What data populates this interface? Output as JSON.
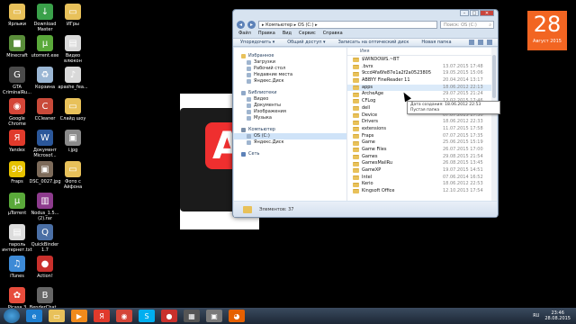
{
  "desktop_icons": [
    {
      "label": "Ярлыки",
      "icon": "folder-icon",
      "color": "#e8c15a",
      "glyph": "▭"
    },
    {
      "label": "Download\nMaster",
      "icon": "download-icon",
      "color": "#3aa14a",
      "glyph": "↓"
    },
    {
      "label": "ИГры",
      "icon": "folder-icon",
      "color": "#e8c15a",
      "glyph": "▭"
    },
    {
      "label": "Minecraft",
      "icon": "grass-block-icon",
      "color": "#5a8e3a",
      "glyph": "■"
    },
    {
      "label": "utorrent.exe",
      "icon": "utorrent-icon",
      "color": "#5aa93a",
      "glyph": "µ"
    },
    {
      "label": "Видео\nвлюкон",
      "icon": "document-icon",
      "color": "#d9d9d9",
      "glyph": "▤"
    },
    {
      "label": "GTA\nCriminalRu...",
      "icon": "gta-icon",
      "color": "#4b4b4b",
      "glyph": "G"
    },
    {
      "label": "Корзина",
      "icon": "recycle-bin-icon",
      "color": "#9bb7d4",
      "glyph": "♻"
    },
    {
      "label": "apashe_fea...",
      "icon": "audio-file-icon",
      "color": "#d9d9d9",
      "glyph": "♪"
    },
    {
      "label": "Google\nChrome",
      "icon": "chrome-icon",
      "color": "#d44638",
      "glyph": "◉"
    },
    {
      "label": "CCleaner",
      "icon": "ccleaner-icon",
      "color": "#c94a3a",
      "glyph": "C"
    },
    {
      "label": "Слайд шоу",
      "icon": "folder-icon",
      "color": "#e8c15a",
      "glyph": "▭"
    },
    {
      "label": "Yandex",
      "icon": "yandex-icon",
      "color": "#e03a2b",
      "glyph": "Я"
    },
    {
      "label": "Документ\nMicrosof...",
      "icon": "word-icon",
      "color": "#2b579a",
      "glyph": "W"
    },
    {
      "label": "i.jpg",
      "icon": "image-file-icon",
      "color": "#8a8a8a",
      "glyph": "▣"
    },
    {
      "label": "Fraps",
      "icon": "fraps-icon",
      "color": "#e6c200",
      "glyph": "99"
    },
    {
      "label": "DSC_0027.jpg",
      "icon": "image-file-icon",
      "color": "#7d6b5a",
      "glyph": "▣"
    },
    {
      "label": "Фото с\nАйфона",
      "icon": "folder-icon",
      "color": "#e8c15a",
      "glyph": "▭"
    },
    {
      "label": "µTorrent",
      "icon": "utorrent-icon",
      "color": "#5aa93a",
      "glyph": "µ"
    },
    {
      "label": "Nodus_1.5...\n(2).rar",
      "icon": "archive-icon",
      "color": "#8d3b8d",
      "glyph": "▥"
    },
    {
      "label": "",
      "icon": "blank-icon",
      "color": "#000000",
      "glyph": ""
    },
    {
      "label": "пароль\nинтернет.txt",
      "icon": "text-file-icon",
      "color": "#dcdcdc",
      "glyph": "▤"
    },
    {
      "label": "QuickBinder\n1.7",
      "icon": "app-icon",
      "color": "#4a6fa5",
      "glyph": "Q"
    },
    {
      "label": "",
      "icon": "blank-icon",
      "color": "#000000",
      "glyph": ""
    },
    {
      "label": "iTunes",
      "icon": "itunes-icon",
      "color": "#3d8ad6",
      "glyph": "♫"
    },
    {
      "label": "Action!",
      "icon": "action-icon",
      "color": "#c9302c",
      "glyph": "●"
    },
    {
      "label": "",
      "icon": "blank-icon",
      "color": "#000000",
      "glyph": ""
    },
    {
      "label": "Picasa 3",
      "icon": "picasa-icon",
      "color": "#e74c3c",
      "glyph": "✿"
    },
    {
      "label": "BenderChat...",
      "icon": "app-icon",
      "color": "#666666",
      "glyph": "B"
    }
  ],
  "window": {
    "address": "▸ Компьютер ▸ OS (C:) ▸",
    "search_placeholder": "Поиск: OS (C:)",
    "menu": [
      "Файл",
      "Правка",
      "Вид",
      "Сервис",
      "Справка"
    ],
    "toolbar": [
      "Упорядочить ▾",
      "Общий доступ ▾",
      "Записать на оптический диск",
      "Новая папка"
    ],
    "nav": {
      "favorites_header": "Избранное",
      "favorites": [
        "Загрузки",
        "Рабочий стол",
        "Недавние места",
        "Яндекс.Диск"
      ],
      "libraries_header": "Библиотеки",
      "libraries": [
        "Видео",
        "Документы",
        "Изображения",
        "Музыка"
      ],
      "computer_header": "Компьютер",
      "computer": [
        "OS (C:)",
        "Яндекс.Диск"
      ],
      "network_header": "Сеть"
    },
    "column_name": "Имя",
    "files": [
      {
        "name": "$WINDOWS.~BT",
        "date": "",
        "hl": false
      },
      {
        "name": ".bvrx",
        "date": "13.07.2015 17:48",
        "hl": false
      },
      {
        "name": "9ccd4fa6fe87e1a2f2a0523805",
        "date": "19.05.2015 15:06",
        "hl": false
      },
      {
        "name": "ABBYY FineReader 11",
        "date": "20.04.2014 13:17",
        "hl": false
      },
      {
        "name": "apps",
        "date": "18.06.2012 22:13",
        "hl": true
      },
      {
        "name": "ArcheAge",
        "date": "29.07.2015 21:24",
        "hl": false
      },
      {
        "name": "CFLog",
        "date": "12.02.2015 17:46",
        "hl": false
      },
      {
        "name": "dell",
        "date": "18.06.2012 22:30",
        "hl": false
      },
      {
        "name": "Device",
        "date": "07.07.2015 17:30",
        "hl": false
      },
      {
        "name": "Drivers",
        "date": "18.06.2012 22:33",
        "hl": false
      },
      {
        "name": "extensions",
        "date": "11.07.2015 17:58",
        "hl": false
      },
      {
        "name": "Fraps",
        "date": "07.07.2015 17:35",
        "hl": false
      },
      {
        "name": "Game",
        "date": "25.06.2015 15:19",
        "hl": false
      },
      {
        "name": "Game Files",
        "date": "26.07.2015 17:00",
        "hl": false
      },
      {
        "name": "Games",
        "date": "29.08.2015 21:54",
        "hl": false
      },
      {
        "name": "GamesMailRu",
        "date": "26.08.2015 13:45",
        "hl": false
      },
      {
        "name": "GameXP",
        "date": "19.07.2015 14:51",
        "hl": false
      },
      {
        "name": "Intel",
        "date": "07.06.2014 16:52",
        "hl": false
      },
      {
        "name": "Kerio",
        "date": "18.06.2012 22:53",
        "hl": false
      },
      {
        "name": "Kingsoft Office",
        "date": "12.10.2013 17:54",
        "hl": false
      }
    ],
    "tooltip_line1": "Дата создания: 18.06.2012 22:53",
    "tooltip_line2": "Пустая папка",
    "status": "Элементов: 37"
  },
  "calendar": {
    "day": "28",
    "month": "Август 2015"
  },
  "taskbar": {
    "apps": [
      {
        "icon": "ie-icon",
        "color": "#1e7fd1",
        "glyph": "e"
      },
      {
        "icon": "explorer-icon",
        "color": "#e8c15a",
        "glyph": "▭"
      },
      {
        "icon": "media-player-icon",
        "color": "#f08a1c",
        "glyph": "▶"
      },
      {
        "icon": "yandex-icon",
        "color": "#e03a2b",
        "glyph": "Я"
      },
      {
        "icon": "chrome-icon",
        "color": "#d44638",
        "glyph": "◉"
      },
      {
        "icon": "skype-icon",
        "color": "#00aff0",
        "glyph": "S"
      },
      {
        "icon": "action-icon",
        "color": "#c9302c",
        "glyph": "●"
      },
      {
        "icon": "app-icon",
        "color": "#555555",
        "glyph": "▦"
      },
      {
        "icon": "video-icon",
        "color": "#7a7a7a",
        "glyph": "▣"
      },
      {
        "icon": "firefox-icon",
        "color": "#e66000",
        "glyph": "◕"
      }
    ],
    "lang": "RU",
    "time": "23:46",
    "date": "28.08.2015"
  }
}
